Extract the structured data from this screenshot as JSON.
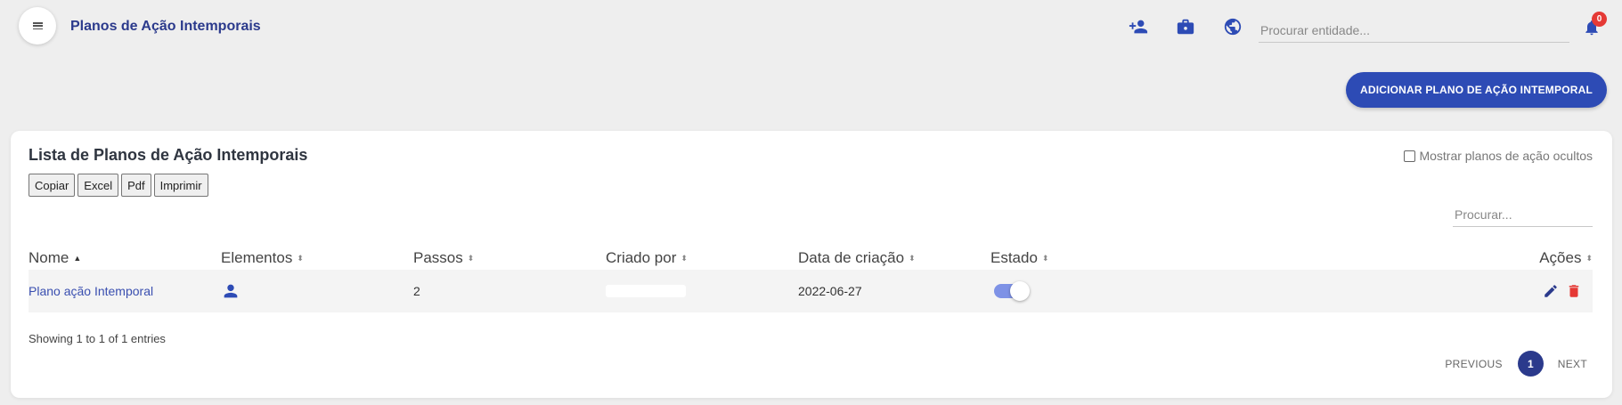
{
  "header": {
    "title": "Planos de Ação Intemporais",
    "search_placeholder": "Procurar entidade...",
    "notification_count": "0",
    "icons": [
      "menu-icon",
      "add-user-icon",
      "toolbox-icon",
      "globe-icon",
      "bell-icon"
    ]
  },
  "actions": {
    "add_label": "ADICIONAR PLANO DE AÇÃO INTEMPORAL"
  },
  "card": {
    "title": "Lista de Planos de Ação Intemporais",
    "show_hidden_label": "Mostrar planos de ação ocultos",
    "show_hidden_checked": false,
    "export_buttons": [
      "Copiar",
      "Excel",
      "Pdf",
      "Imprimir"
    ],
    "search_placeholder": "Procurar..."
  },
  "table": {
    "columns": [
      "Nome",
      "Elementos",
      "Passos",
      "Criado por",
      "Data de criação",
      "Estado",
      "Ações"
    ],
    "sorted_column": "Nome",
    "sort_direction": "asc",
    "rows": [
      {
        "nome": "Plano ação Intemporal",
        "elementos_icon": "user-icon",
        "passos": "2",
        "criado_por": "",
        "data_criacao": "2022-06-27",
        "estado_active": true
      }
    ]
  },
  "footer": {
    "info": "Showing 1 to 1 of 1 entries",
    "previous_label": "PREVIOUS",
    "next_label": "NEXT",
    "current_page": "1"
  },
  "colors": {
    "primary": "#2d4bb5",
    "title": "#2b3a8c",
    "link": "#3a4fb0",
    "delete": "#e53935",
    "toggle_track": "#7e92e6",
    "background": "#eeeeee"
  }
}
